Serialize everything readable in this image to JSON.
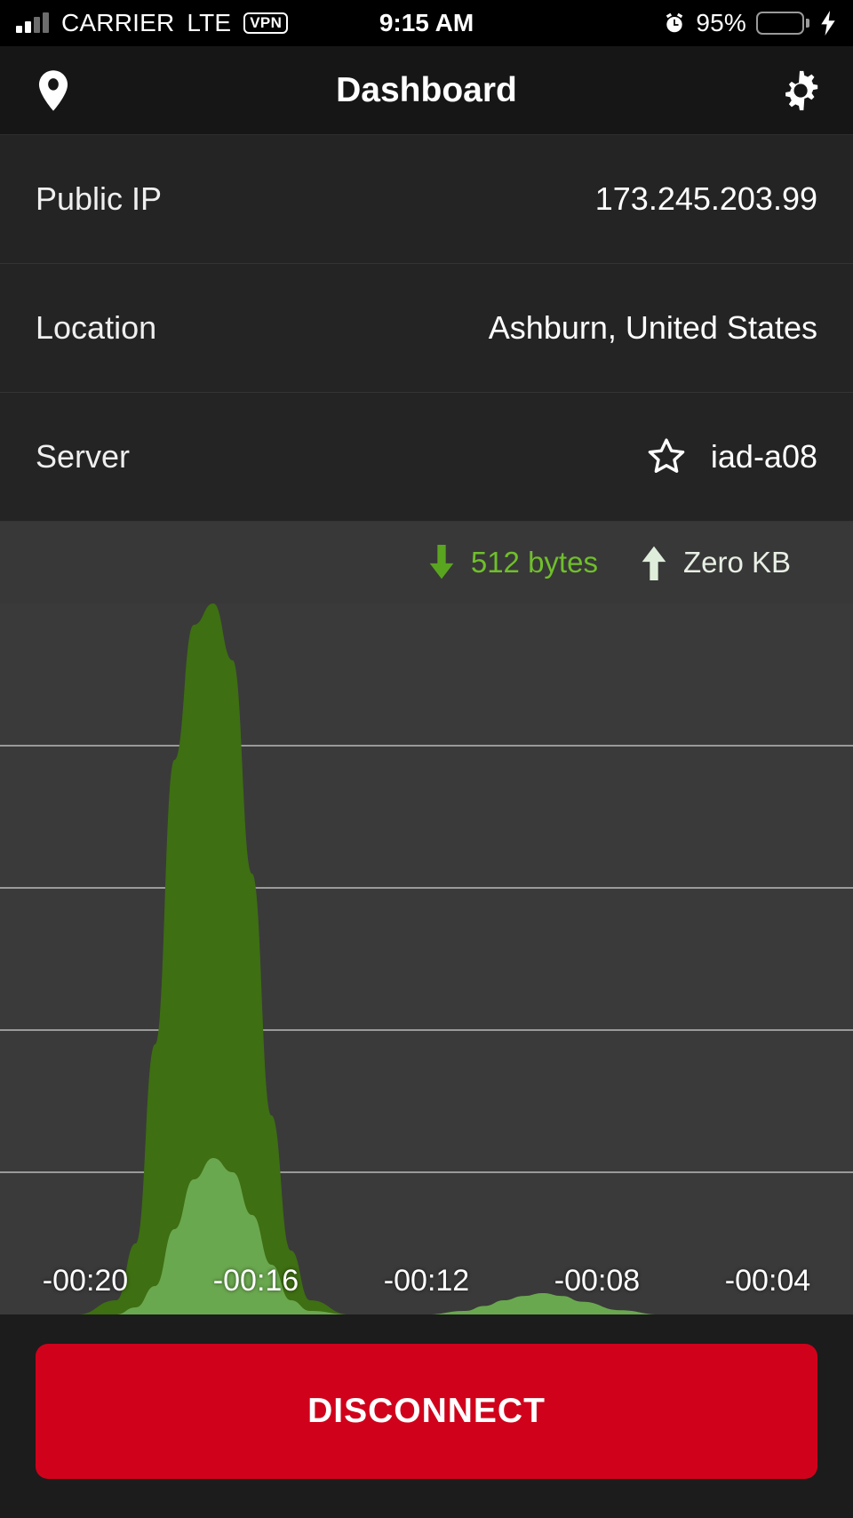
{
  "status_bar": {
    "carrier": "CARRIER",
    "network_type": "LTE",
    "vpn_badge": "VPN",
    "time": "9:15 AM",
    "battery_percent": "95%",
    "signal_bars_filled": 2,
    "signal_bars_total": 4
  },
  "nav": {
    "title": "Dashboard",
    "left_icon": "location-pin-icon",
    "right_icon": "gear-icon"
  },
  "info": {
    "rows": [
      {
        "label": "Public IP",
        "value": "173.245.203.99"
      },
      {
        "label": "Location",
        "value": "Ashburn, United States"
      },
      {
        "label": "Server",
        "value": "iad-a08",
        "has_favorite_star": true
      }
    ]
  },
  "traffic": {
    "download_label": "512 bytes",
    "upload_label": "Zero KB",
    "download_color": "#6fbf2b",
    "upload_color": "#e8efe4"
  },
  "actions": {
    "disconnect_label": "DISCONNECT",
    "disconnect_color": "#d0021b"
  },
  "chart_data": {
    "type": "area",
    "title": "",
    "xlabel": "",
    "ylabel": "",
    "grid": true,
    "gridlines": 4,
    "legend_position": "top-right",
    "x_tick_labels": [
      "-00:20",
      "-00:16",
      "-00:12",
      "-00:08",
      "-00:04"
    ],
    "x": [
      -22,
      -21,
      -20,
      -19,
      -18.5,
      -18,
      -17.5,
      -17,
      -16.5,
      -16,
      -15.5,
      -15,
      -14.5,
      -14,
      -13,
      -12,
      -11,
      -10,
      -9.5,
      -9,
      -8.5,
      -8,
      -7.5,
      -7,
      -6,
      -5,
      -4,
      -3,
      -2,
      -1,
      0
    ],
    "xlim": [
      -22,
      0
    ],
    "ylim": [
      0,
      1
    ],
    "series": [
      {
        "name": "download",
        "color": "#3e6f12",
        "values": [
          0,
          0,
          0,
          0.02,
          0.1,
          0.38,
          0.78,
          0.97,
          1.0,
          0.92,
          0.62,
          0.28,
          0.09,
          0.02,
          0,
          0,
          0,
          0,
          0,
          0,
          0,
          0,
          0,
          0,
          0,
          0,
          0,
          0,
          0,
          0,
          0
        ]
      },
      {
        "name": "upload",
        "color": "#6aa84f",
        "values": [
          0,
          0,
          0,
          0,
          0.01,
          0.04,
          0.12,
          0.19,
          0.22,
          0.2,
          0.14,
          0.07,
          0.02,
          0.005,
          0,
          0,
          0,
          0.005,
          0.012,
          0.02,
          0.026,
          0.03,
          0.026,
          0.018,
          0.006,
          0,
          0,
          0,
          0,
          0,
          0
        ]
      }
    ]
  }
}
